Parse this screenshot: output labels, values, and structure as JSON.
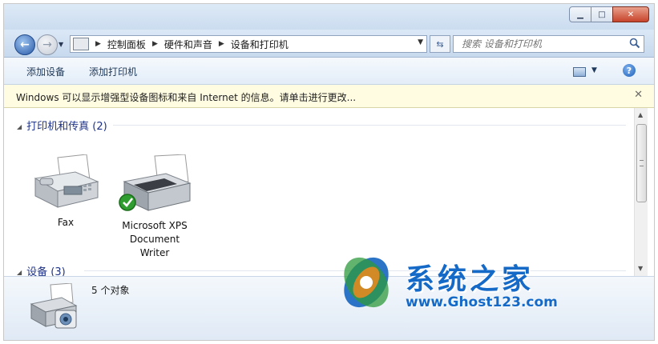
{
  "address_bar": {
    "breadcrumbs": [
      "控制面板",
      "硬件和声音",
      "设备和打印机"
    ]
  },
  "search": {
    "placeholder": "搜索 设备和打印机"
  },
  "commands": {
    "add_device": "添加设备",
    "add_printer": "添加打印机"
  },
  "info_bar": {
    "message": "Windows 可以显示增强型设备图标和来自 Internet 的信息。请单击进行更改..."
  },
  "groups": [
    {
      "header": "打印机和传真 (2)",
      "items": [
        {
          "label": "Fax",
          "icon": "fax-icon"
        },
        {
          "label": "Microsoft XPS Document Writer",
          "icon": "printer-icon",
          "default_check": true
        }
      ]
    },
    {
      "header": "设备 (3)",
      "items": []
    }
  ],
  "details": {
    "count": "5 个对象"
  },
  "watermark": {
    "title": "系统之家",
    "url": "www.Ghost123.com"
  },
  "colors": {
    "accent": "#1569c7",
    "group_header": "#1e3287",
    "info_bar_bg": "#fffce1"
  }
}
